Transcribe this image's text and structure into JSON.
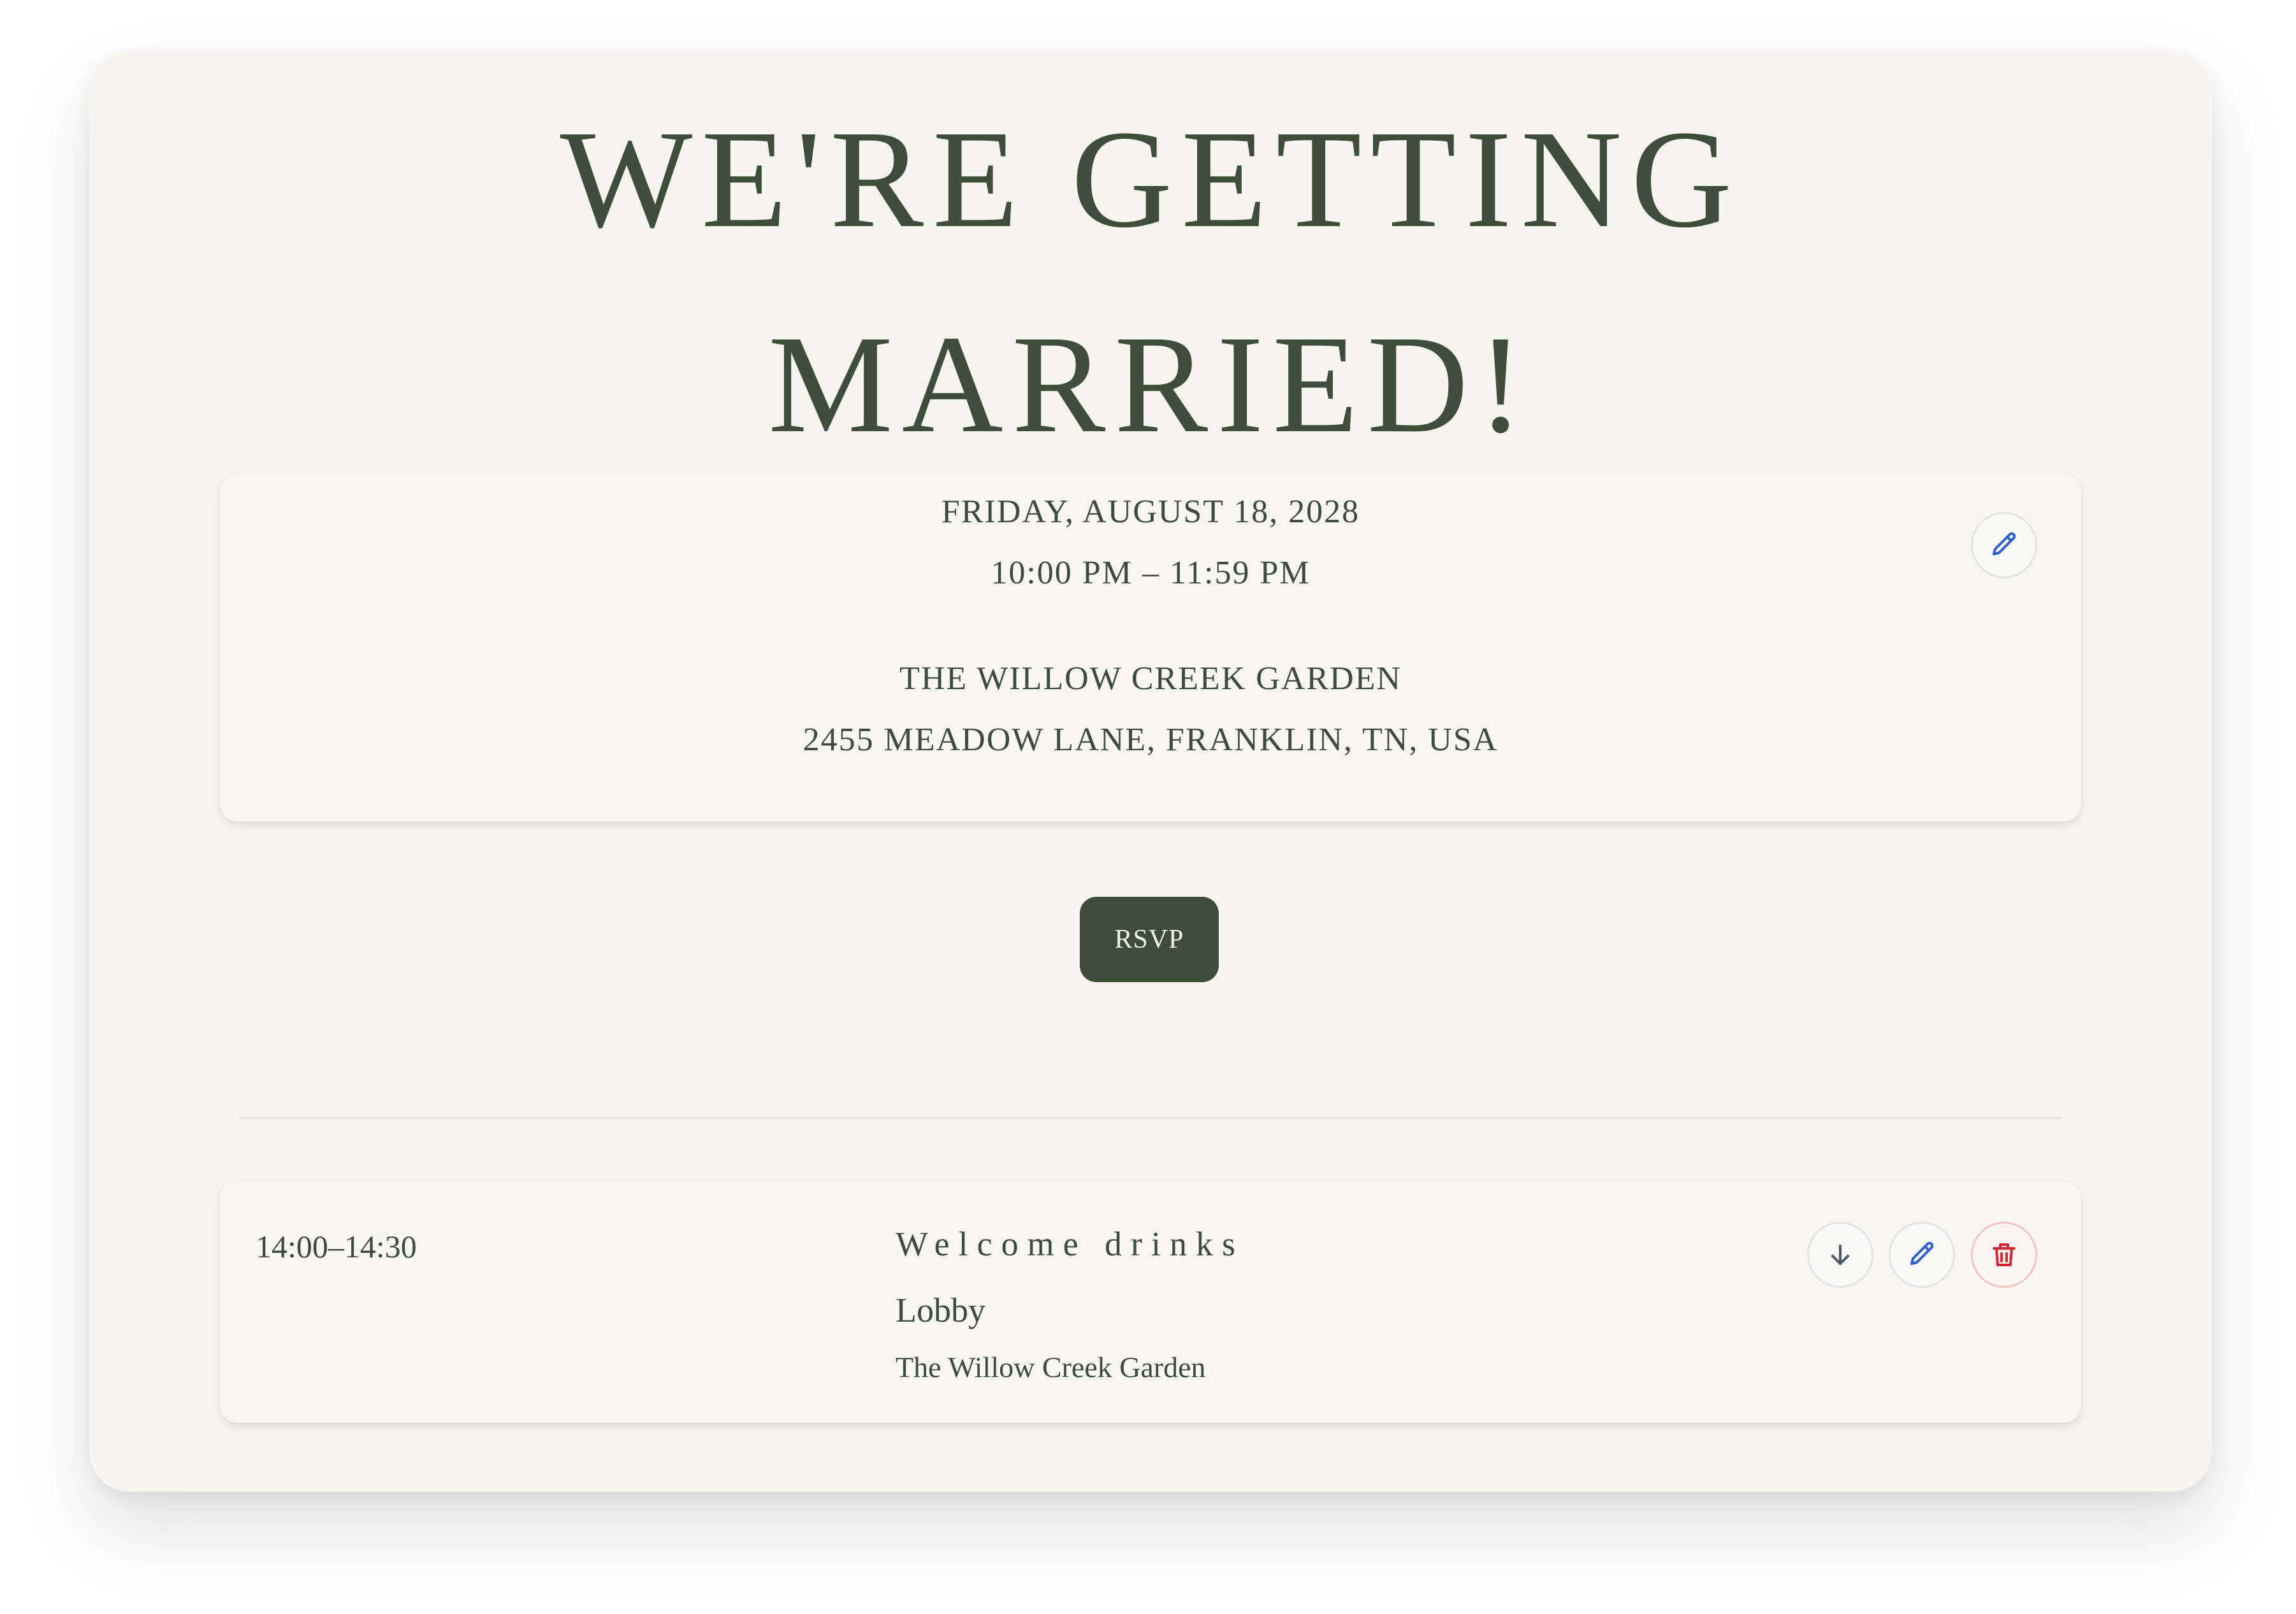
{
  "header": {
    "title_line1": "WE'RE GETTING",
    "title_line2": "MARRIED!"
  },
  "details": {
    "date": "FRIDAY, AUGUST 18, 2028",
    "time": "10:00 PM – 11:59 PM",
    "venue": "THE WILLOW CREEK GARDEN",
    "address": "2455 MEADOW LANE, FRANKLIN, TN, USA",
    "edit_icon": "pencil-icon"
  },
  "rsvp": {
    "label": "RSVP"
  },
  "schedule": {
    "items": [
      {
        "time": "14:00–14:30",
        "name": "Welcome drinks",
        "location": "Lobby",
        "venue": "The Willow Creek Garden",
        "actions": [
          "arrow-down-icon",
          "pencil-icon",
          "trash-icon"
        ]
      }
    ]
  },
  "colors": {
    "background": "#f7f5ef",
    "primary": "#3d4d39",
    "edit_icon": "#2f5fd0",
    "delete_icon": "#d0282e"
  }
}
